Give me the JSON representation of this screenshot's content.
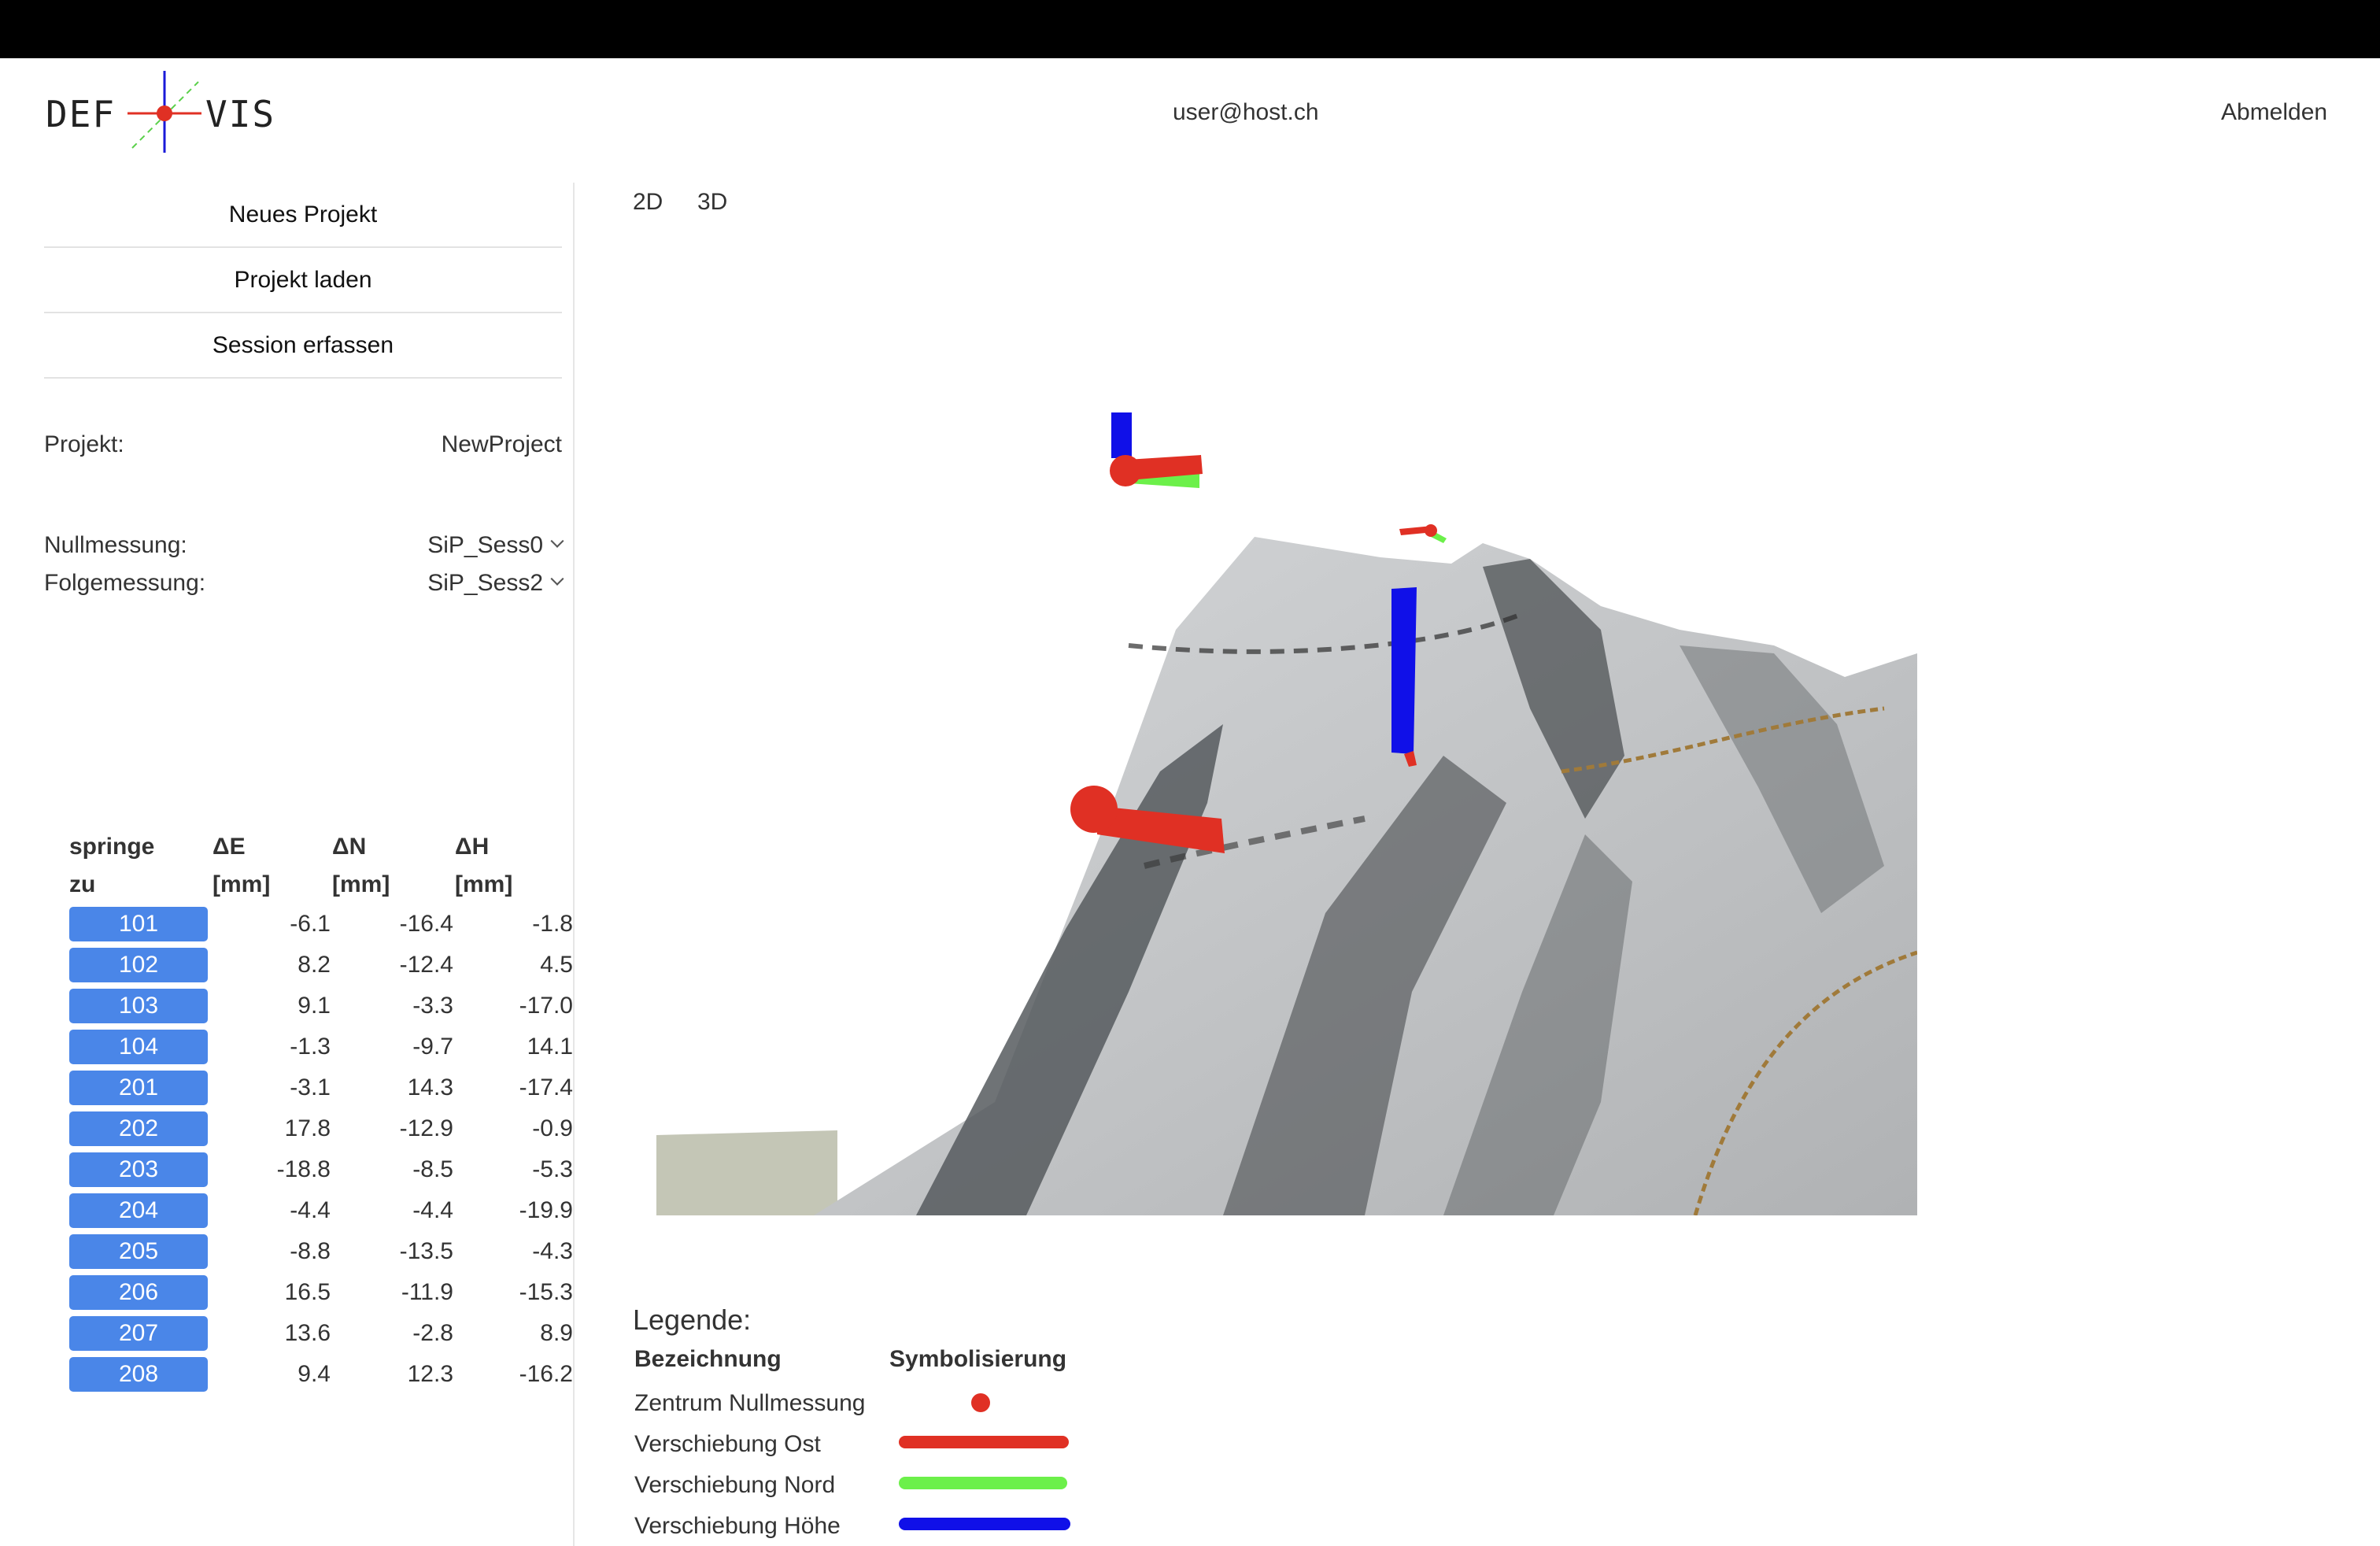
{
  "header": {
    "logo_left": "DEF",
    "logo_right": "VIS",
    "user_email": "user@host.ch",
    "logout_label": "Abmelden"
  },
  "sidebar": {
    "menu": [
      {
        "label": "Neues Projekt"
      },
      {
        "label": "Projekt laden"
      },
      {
        "label": "Session erfassen"
      }
    ],
    "project_label": "Projekt:",
    "project_value": "NewProject",
    "baseline_label": "Nullmessung:",
    "baseline_value": "SiP_Sess0",
    "followup_label": "Folgemessung:",
    "followup_value": "SiP_Sess2"
  },
  "table": {
    "headers": [
      {
        "line1": "springe",
        "line2": "zu"
      },
      {
        "line1": "ΔE",
        "line2": "[mm]"
      },
      {
        "line1": "ΔN",
        "line2": "[mm]"
      },
      {
        "line1": "ΔH",
        "line2": "[mm]"
      }
    ],
    "rows": [
      {
        "point": "101",
        "de": "-6.1",
        "dn": "-16.4",
        "dh": "-1.8"
      },
      {
        "point": "102",
        "de": "8.2",
        "dn": "-12.4",
        "dh": "4.5"
      },
      {
        "point": "103",
        "de": "9.1",
        "dn": "-3.3",
        "dh": "-17.0"
      },
      {
        "point": "104",
        "de": "-1.3",
        "dn": "-9.7",
        "dh": "14.1"
      },
      {
        "point": "201",
        "de": "-3.1",
        "dn": "14.3",
        "dh": "-17.4"
      },
      {
        "point": "202",
        "de": "17.8",
        "dn": "-12.9",
        "dh": "-0.9"
      },
      {
        "point": "203",
        "de": "-18.8",
        "dn": "-8.5",
        "dh": "-5.3"
      },
      {
        "point": "204",
        "de": "-4.4",
        "dn": "-4.4",
        "dh": "-19.9"
      },
      {
        "point": "205",
        "de": "-8.8",
        "dn": "-13.5",
        "dh": "-4.3"
      },
      {
        "point": "206",
        "de": "16.5",
        "dn": "-11.9",
        "dh": "-15.3"
      },
      {
        "point": "207",
        "de": "13.6",
        "dn": "-2.8",
        "dh": "8.9"
      },
      {
        "point": "208",
        "de": "9.4",
        "dn": "12.3",
        "dh": "-16.2"
      }
    ]
  },
  "view_tabs": {
    "tab_2d": "2D",
    "tab_3d": "3D"
  },
  "legend": {
    "title": "Legende:",
    "col_name": "Bezeichnung",
    "col_symbol": "Symbolisierung",
    "items": [
      {
        "label": "Zentrum Nullmessung",
        "color": "#e03024",
        "symbol": "dot"
      },
      {
        "label": "Verschiebung Ost",
        "color": "#e03024",
        "symbol": "line"
      },
      {
        "label": "Verschiebung Nord",
        "color": "#6cf04a",
        "symbol": "line"
      },
      {
        "label": "Verschiebung Höhe",
        "color": "#1010e8",
        "symbol": "line"
      }
    ]
  },
  "colors": {
    "accent_button": "#4a86e8",
    "east": "#e03024",
    "north": "#6cf04a",
    "height": "#1010e8"
  }
}
